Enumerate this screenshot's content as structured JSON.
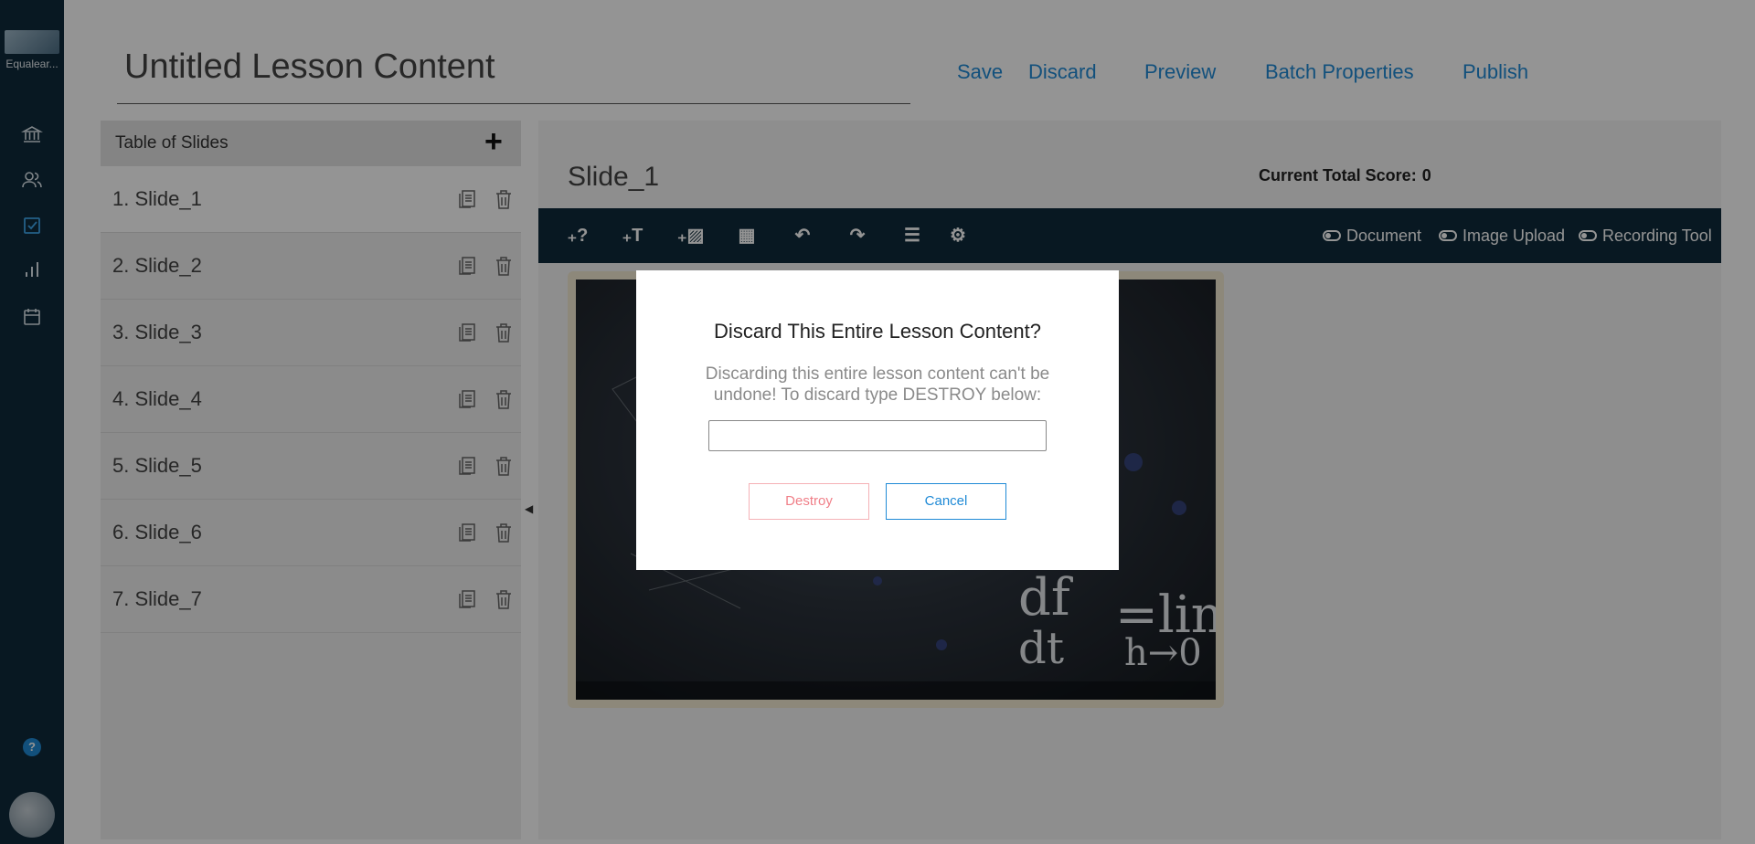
{
  "nav": {
    "logo_text": "Equalear...",
    "items": [
      {
        "icon": "institution-icon"
      },
      {
        "icon": "users-icon"
      },
      {
        "icon": "edit-check-icon"
      },
      {
        "icon": "bar-chart-icon"
      },
      {
        "icon": "calendar-icon"
      }
    ],
    "help_label": "?"
  },
  "header": {
    "title": "Untitled Lesson Content",
    "links": [
      "Save",
      "Discard",
      "Preview",
      "Batch Properties",
      "Publish"
    ]
  },
  "sidebar": {
    "heading": "Table of Slides",
    "add_label": "+",
    "slides": [
      "1. Slide_1",
      "2. Slide_2",
      "3. Slide_3",
      "4. Slide_4",
      "5. Slide_5",
      "6. Slide_6",
      "7. Slide_7"
    ]
  },
  "main": {
    "slide_title": "Slide_1",
    "score_label": "Current Total Score:",
    "score_value": "0",
    "toolbar": {
      "tools": [
        {
          "icon": "add-question-icon",
          "glyph": "₊?"
        },
        {
          "icon": "add-text-icon",
          "glyph": "₊T"
        },
        {
          "icon": "add-image-icon",
          "glyph": "₊▨"
        },
        {
          "icon": "film-icon",
          "glyph": "▦"
        },
        {
          "icon": "undo-icon",
          "glyph": "↶"
        },
        {
          "icon": "redo-icon",
          "glyph": "↷"
        },
        {
          "icon": "list-icon",
          "glyph": "☰"
        },
        {
          "icon": "settings-icon",
          "glyph": "⚙"
        }
      ],
      "toggles": [
        "Document",
        "Image Upload",
        "Recording Tool"
      ]
    }
  },
  "modal": {
    "title": "Discard This Entire Lesson Content?",
    "message": "Discarding this entire lesson content can't be undone! To discard type DESTROY below:",
    "input_value": "",
    "destroy_label": "Destroy",
    "cancel_label": "Cancel"
  },
  "colors": {
    "nav_bg": "#0e2a3b",
    "accent": "#1f8ad6",
    "danger": "#f07f88"
  }
}
